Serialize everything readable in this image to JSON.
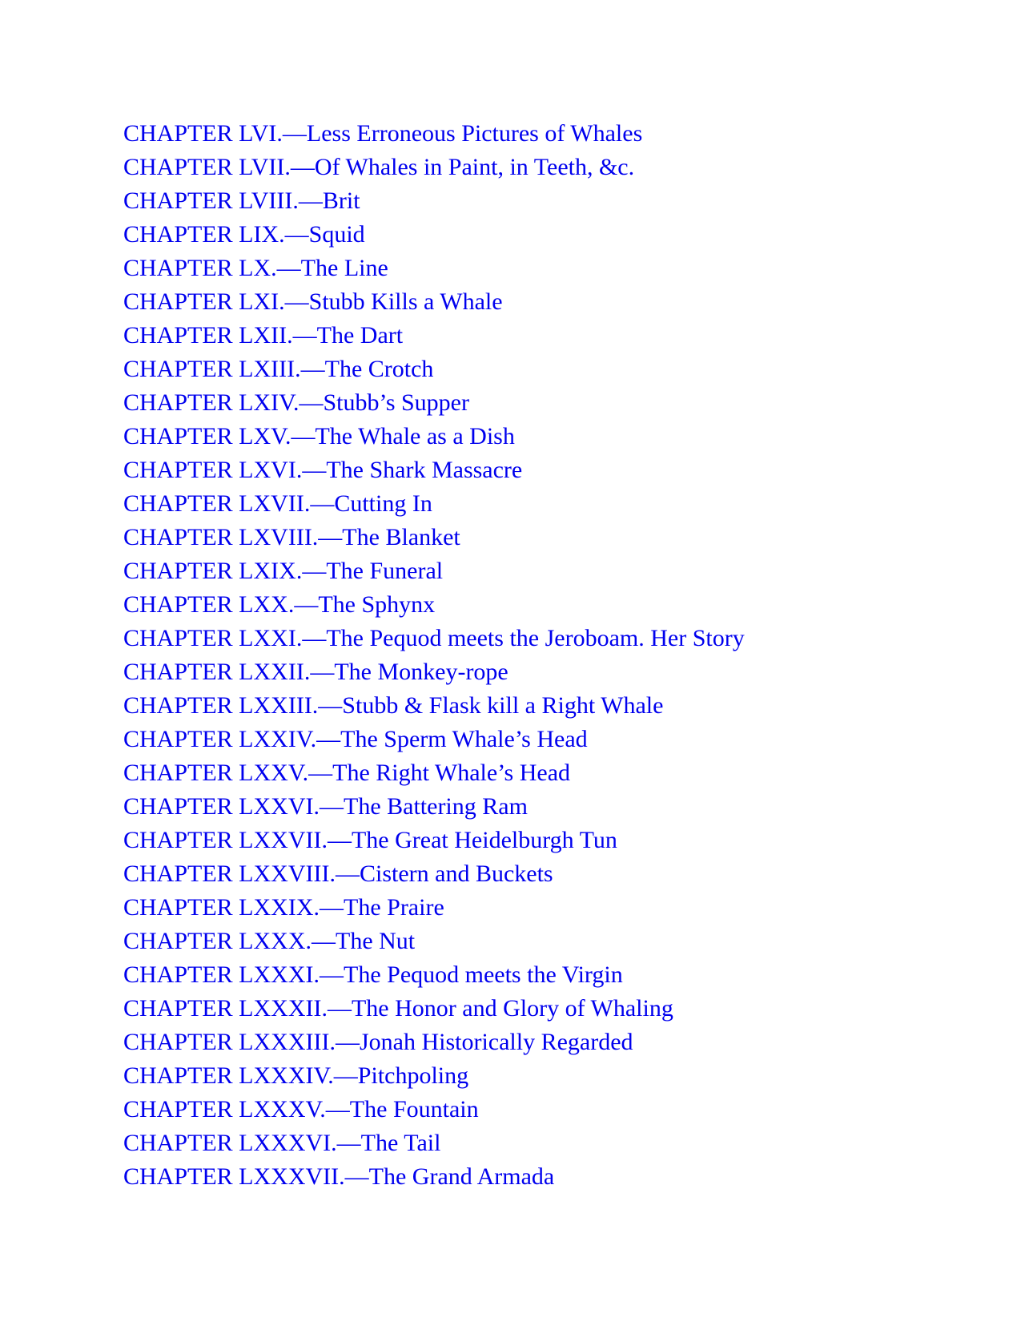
{
  "toc": {
    "entries": [
      "CHAPTER LVI.—Less Erroneous Pictures of Whales",
      "CHAPTER LVII.—Of Whales in Paint, in Teeth, &c.",
      "CHAPTER LVIII.—Brit",
      "CHAPTER LIX.—Squid",
      "CHAPTER LX.—The Line",
      "CHAPTER LXI.—Stubb Kills a Whale",
      "CHAPTER LXII.—The Dart",
      "CHAPTER LXIII.—The Crotch",
      "CHAPTER LXIV.—Stubb’s Supper",
      "CHAPTER LXV.—The Whale as a Dish",
      "CHAPTER LXVI.—The Shark Massacre",
      "CHAPTER LXVII.—Cutting In",
      "CHAPTER LXVIII.—The Blanket",
      "CHAPTER LXIX.—The Funeral",
      "CHAPTER LXX.—The Sphynx",
      "CHAPTER LXXI.—The Pequod meets the Jeroboam. Her Story",
      "CHAPTER LXXII.—The Monkey-rope",
      "CHAPTER LXXIII.—Stubb & Flask kill a Right Whale",
      "CHAPTER LXXIV.—The Sperm Whale’s Head",
      "CHAPTER LXXV.—The Right Whale’s Head",
      "CHAPTER LXXVI.—The Battering Ram",
      "CHAPTER LXXVII.—The Great Heidelburgh Tun",
      "CHAPTER LXXVIII.—Cistern and Buckets",
      "CHAPTER LXXIX.—The Praire",
      "CHAPTER LXXX.—The Nut",
      "CHAPTER LXXXI.—The Pequod meets the Virgin",
      "CHAPTER LXXXII.—The Honor and Glory of Whaling",
      "CHAPTER LXXXIII.—Jonah Historically Regarded",
      "CHAPTER LXXXIV.—Pitchpoling",
      "CHAPTER LXXXV.—The Fountain",
      "CHAPTER LXXXVI.—The Tail",
      "CHAPTER LXXXVII.—The Grand Armada"
    ]
  },
  "colors": {
    "link": "#0000ee",
    "background": "#ffffff"
  }
}
